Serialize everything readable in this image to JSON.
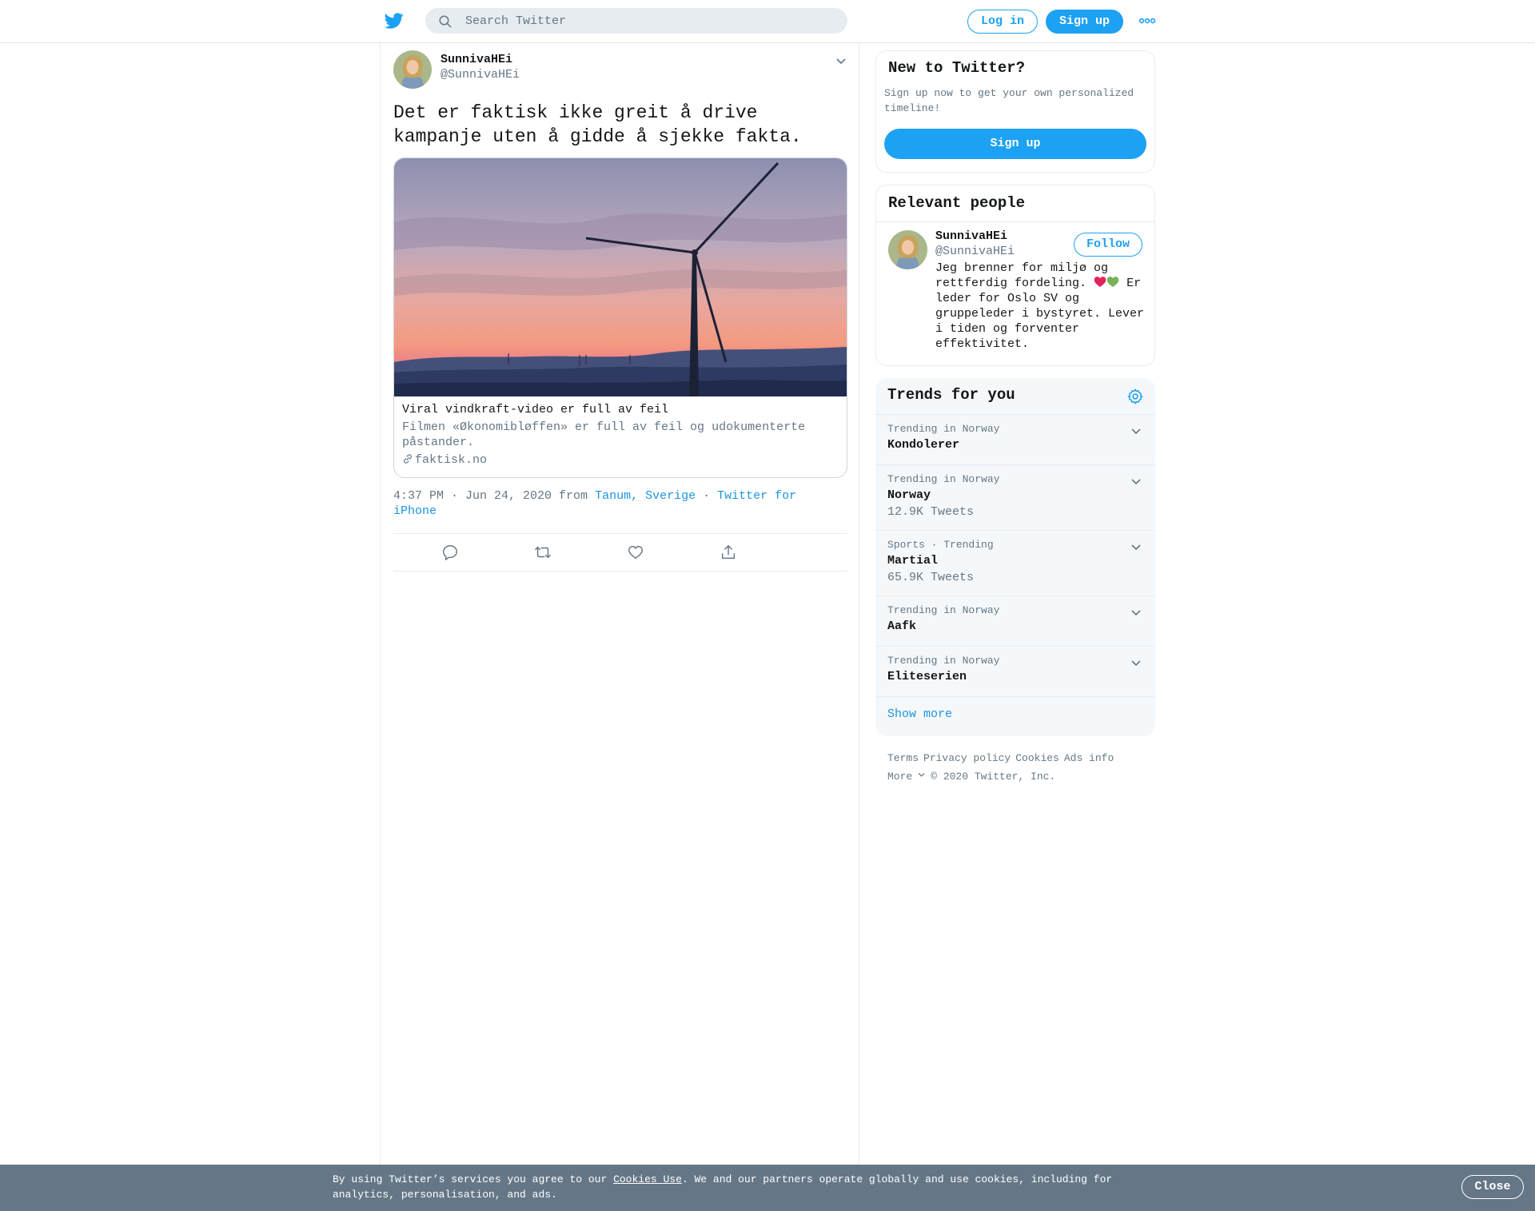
{
  "header": {
    "search_placeholder": "Search Twitter",
    "login_label": "Log in",
    "signup_label": "Sign up",
    "brand_color": "#1da1f2",
    "icons": [
      "twitter-bird-icon",
      "search-icon",
      "more-dots-icon"
    ]
  },
  "tweet": {
    "display_name": "SunnivaHEi",
    "handle": "@SunnivaHEi",
    "text": "Det er faktisk ikke greit å drive kampanje uten å gidde å sjekke fakta.",
    "card": {
      "title": "Viral vindkraft-video er full av feil",
      "description": "Filmen «Økonomibløffen» er full av feil og udokumenterte påstander.",
      "domain": "faktisk.no"
    },
    "meta": {
      "time": "4:37 PM · Jun 24, 2020 from",
      "location": "Tanum, Sverige",
      "separator": "·",
      "source": "Twitter for iPhone"
    },
    "action_icons": [
      "reply-icon",
      "retweet-icon",
      "like-icon",
      "share-icon"
    ]
  },
  "new_to_twitter": {
    "title": "New to Twitter?",
    "subtitle": "Sign up now to get your own personalized timeline!",
    "signup_label": "Sign up"
  },
  "relevant_people": {
    "title": "Relevant people",
    "person": {
      "display_name": "SunnivaHEi",
      "handle": "@SunnivaHEi",
      "follow_label": "Follow",
      "bio_line1": "Jeg brenner for miljø og rettferdig fordeling.",
      "bio_line2": "Er leder for Oslo SV og gruppeleder i bystyret. Lever i tiden og forventer effektivitet.",
      "heart_colors": [
        "#e0245e",
        "#77b255"
      ]
    }
  },
  "trends": {
    "title": "Trends for you",
    "items": [
      {
        "context": "Trending in Norway",
        "name": "Kondolerer",
        "count": ""
      },
      {
        "context": "Trending in Norway",
        "name": "Norway",
        "count": "12.9K Tweets"
      },
      {
        "context": "Sports · Trending",
        "name": "Martial",
        "count": "65.9K Tweets"
      },
      {
        "context": "Trending in Norway",
        "name": "Aafk",
        "count": ""
      },
      {
        "context": "Trending in Norway",
        "name": "Eliteserien",
        "count": ""
      }
    ],
    "show_more": "Show more"
  },
  "footer": {
    "terms": "Terms",
    "privacy": "Privacy policy",
    "cookies": "Cookies",
    "ads": "Ads info",
    "more": "More",
    "copyright": "© 2020 Twitter, Inc."
  },
  "cookie_bar": {
    "text_before": "By using Twitter’s services you agree to our ",
    "link": "Cookies Use",
    "text_after": ". We and our partners operate globally and use cookies, including for analytics, personalisation, and ads.",
    "close_label": "Close"
  }
}
